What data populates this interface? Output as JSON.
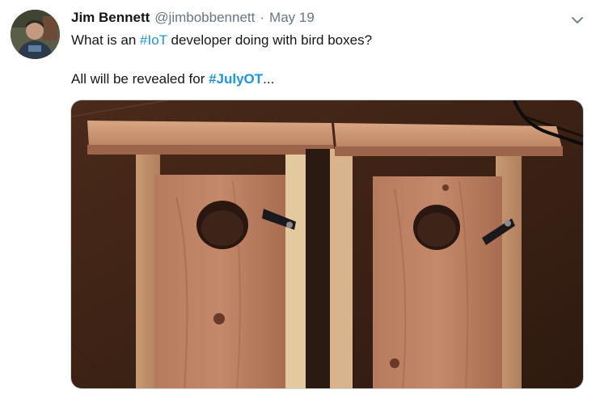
{
  "author": {
    "display_name": "Jim Bennett",
    "handle": "@jimbobbennett",
    "separator": "·",
    "date": "May 19"
  },
  "tweet": {
    "line1_before": "What is an ",
    "line1_hashtag": "#IoT",
    "line1_after": " developer doing with bird boxes?",
    "line2_before": "All will be revealed for ",
    "line2_hashtag": "#JulyOT",
    "line2_after": "..."
  },
  "colors": {
    "link": "#1b95e0",
    "text": "#14171a",
    "muted": "#657786"
  },
  "icons": {
    "caret": "chevron-down-icon"
  }
}
